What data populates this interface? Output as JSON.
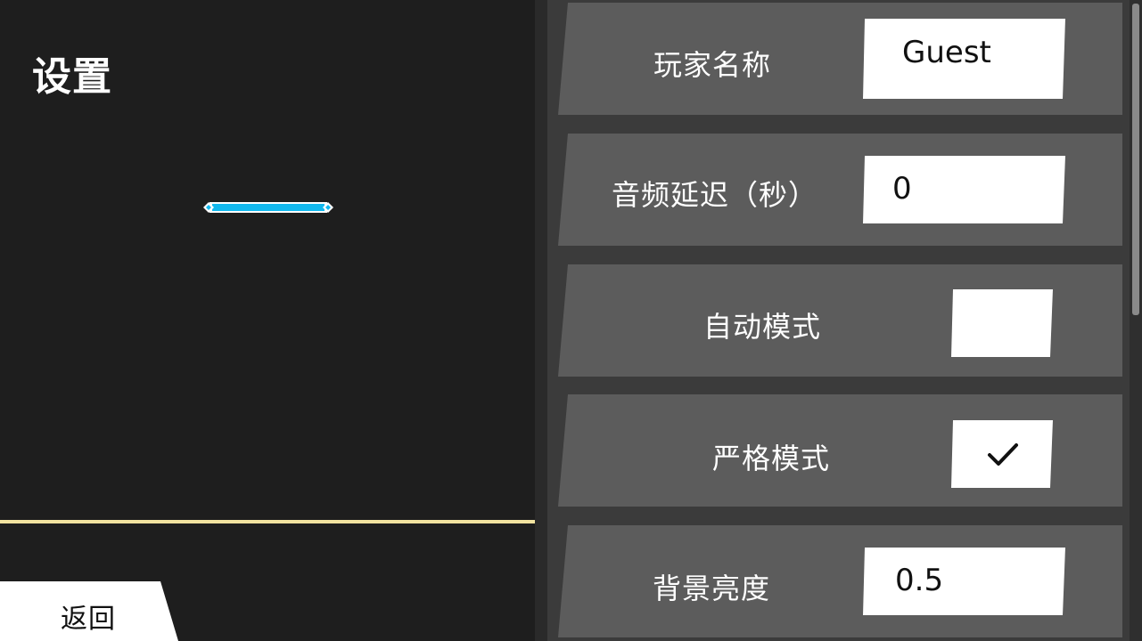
{
  "title": "设置",
  "back_label": "返回",
  "accent_colors": {
    "note": "#11b8ee",
    "judge_line": "#f2e3a0",
    "row_bg": "#5c5c5c"
  },
  "settings": {
    "player_name": {
      "label": "玩家名称",
      "value": "Guest"
    },
    "audio_delay": {
      "label": "音频延迟（秒）",
      "value": "0"
    },
    "auto_mode": {
      "label": "自动模式",
      "checked": false,
      "check_glyph": ""
    },
    "strict_mode": {
      "label": "严格模式",
      "checked": true,
      "check_glyph": "✓"
    },
    "bg_brightness": {
      "label": "背景亮度",
      "value": "0.5"
    }
  }
}
